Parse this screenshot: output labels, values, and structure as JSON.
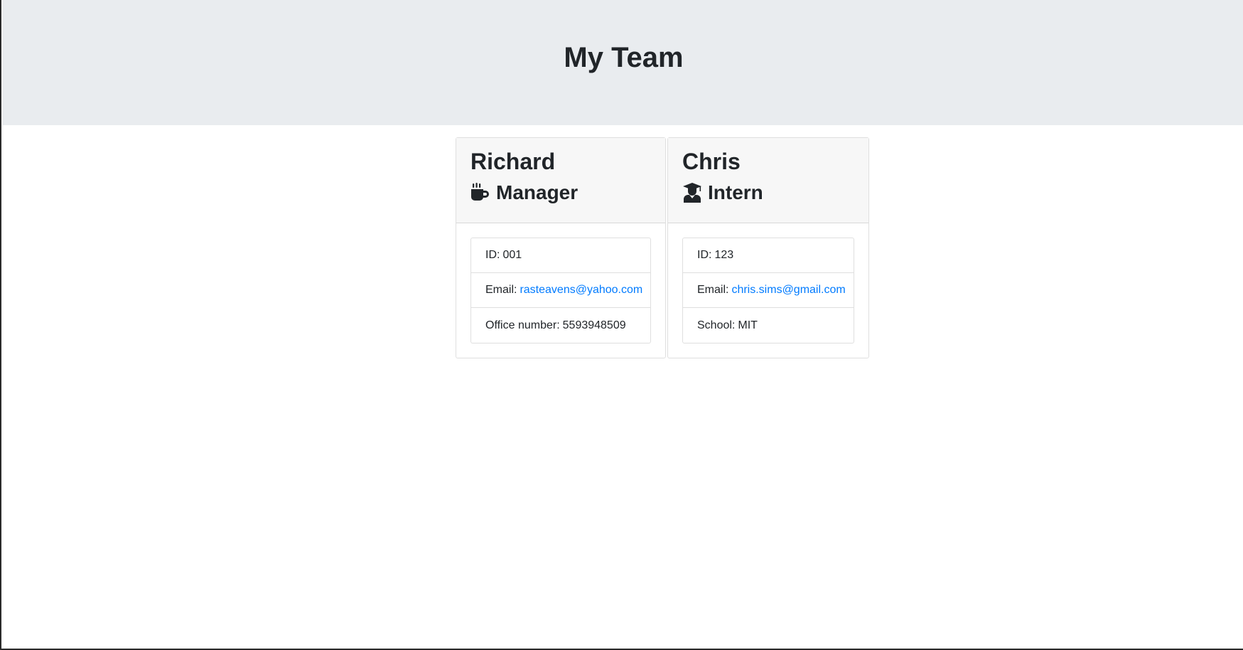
{
  "header": {
    "title": "My Team"
  },
  "team": [
    {
      "name": "Richard",
      "role": "Manager",
      "role_icon": "coffee-mug-icon",
      "id_label": "ID:",
      "id": "001",
      "email_label": "Email:",
      "email": "rasteavens@yahoo.com",
      "extra_label": "Office number:",
      "extra_value": "5593948509"
    },
    {
      "name": "Chris",
      "role": "Intern",
      "role_icon": "graduate-icon",
      "id_label": "ID:",
      "id": "123",
      "email_label": "Email:",
      "email": "chris.sims@gmail.com",
      "extra_label": "School:",
      "extra_value": "MIT"
    }
  ],
  "colors": {
    "header_bg": "#e9ecef",
    "link": "#007bff",
    "card_header_bg": "#f7f7f7",
    "text": "#212529"
  }
}
